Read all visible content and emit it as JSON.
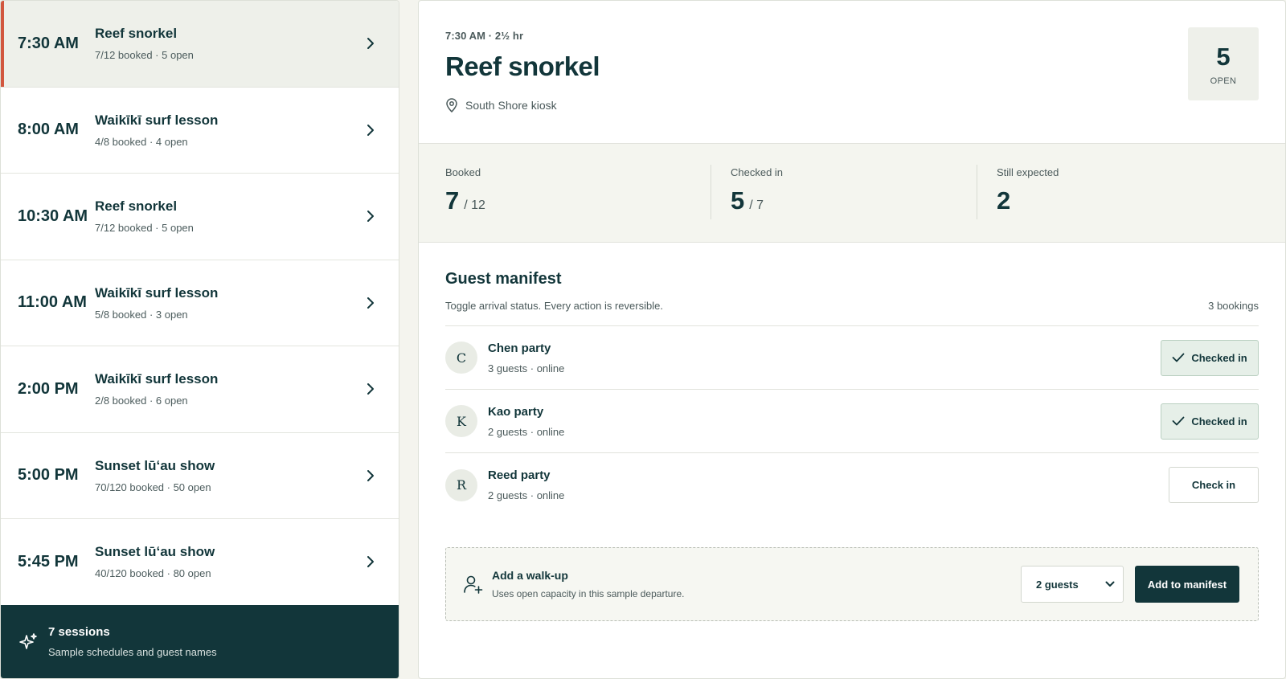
{
  "sessions": [
    {
      "time": "7:30 AM",
      "title": "Reef snorkel",
      "meta": "7/12 booked · 5 open",
      "active": true
    },
    {
      "time": "8:00 AM",
      "title": "Waikīkī surf lesson",
      "meta": "4/8 booked · 4 open"
    },
    {
      "time": "10:30 AM",
      "title": "Reef snorkel",
      "meta": "7/12 booked · 5 open"
    },
    {
      "time": "11:00 AM",
      "title": "Waikīkī surf lesson",
      "meta": "5/8 booked · 3 open"
    },
    {
      "time": "2:00 PM",
      "title": "Waikīkī surf lesson",
      "meta": "2/8 booked · 6 open"
    },
    {
      "time": "5:00 PM",
      "title": "Sunset lūʻau show",
      "meta": "70/120 booked · 50 open"
    },
    {
      "time": "5:45 PM",
      "title": "Sunset lūʻau show",
      "meta": "40/120 booked · 80 open"
    }
  ],
  "sidebar_footer": {
    "title": "7 sessions",
    "subtitle": "Sample schedules and guest names",
    "icon": "sparkle-icon"
  },
  "detail": {
    "eyebrow": "7:30 AM · 2½ hr",
    "title": "Reef snorkel",
    "location": "South Shore kiosk",
    "open_count": "5",
    "open_label": "OPEN"
  },
  "stats": {
    "booked": {
      "label": "Booked",
      "value": "7",
      "total": "/ 12"
    },
    "checked_in": {
      "label": "Checked in",
      "value": "5",
      "total": "/ 7"
    },
    "still_expected": {
      "label": "Still expected",
      "value": "2"
    }
  },
  "manifest": {
    "title": "Guest manifest",
    "subtitle": "Toggle arrival status. Every action is reversible.",
    "count": "3 bookings",
    "guests": [
      {
        "initial": "C",
        "name": "Chen party",
        "meta": "3 guests · online",
        "status": "Checked in",
        "checked": true
      },
      {
        "initial": "K",
        "name": "Kao party",
        "meta": "2 guests · online",
        "status": "Checked in",
        "checked": true
      },
      {
        "initial": "R",
        "name": "Reed party",
        "meta": "2 guests · online",
        "status": "Check in",
        "checked": false
      }
    ]
  },
  "walkup": {
    "title": "Add a walk-up",
    "subtitle": "Uses open capacity in this sample departure.",
    "select_value": "2 guests",
    "button_label": "Add to manifest"
  },
  "colors": {
    "primary": "#12363a",
    "accent": "#d2573f",
    "checked_bg": "#e6efe8",
    "panel_bg": "#f4f5ef"
  }
}
